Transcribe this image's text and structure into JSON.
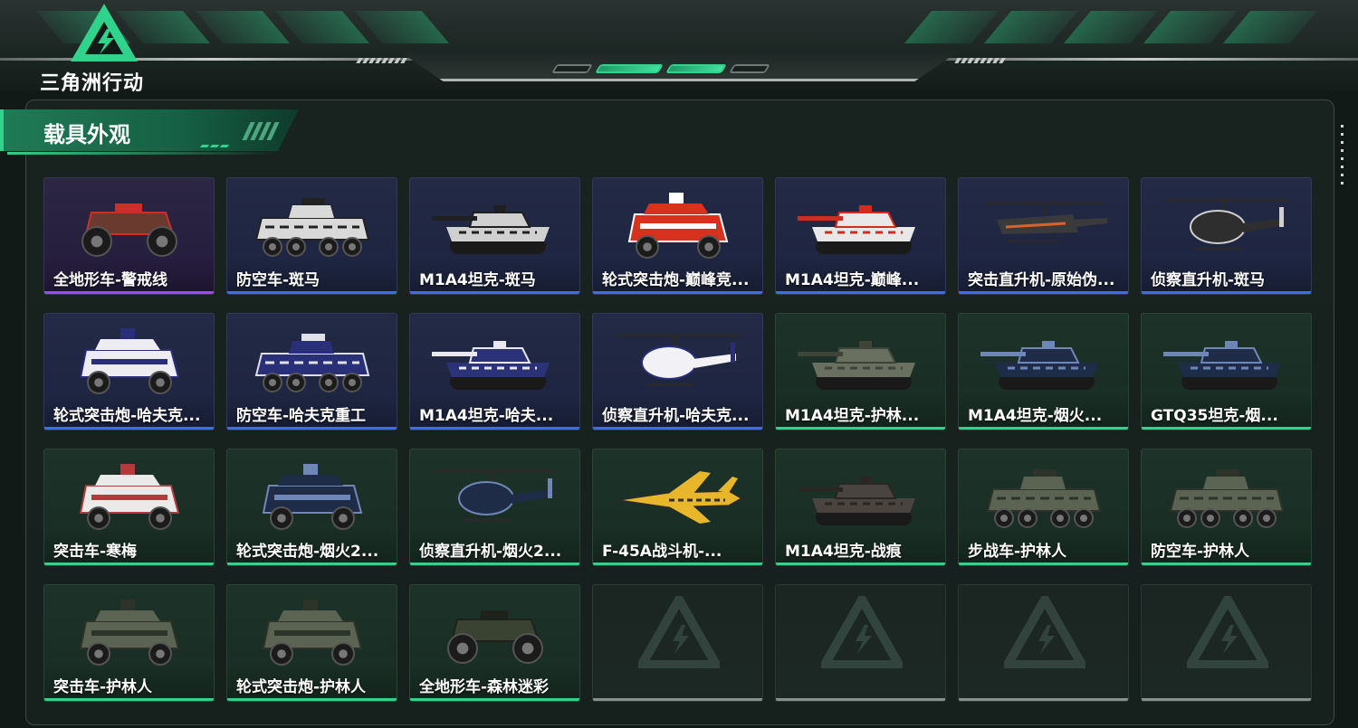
{
  "app": {
    "logo_text": "三角洲行动",
    "logo_icon": "delta-triangle-lightning-icon"
  },
  "section": {
    "title": "载具外观"
  },
  "colors": {
    "accent": "#2fd38c",
    "rarity_purple": "#9b4cf0",
    "rarity_blue": "#3a6ff0",
    "rarity_green": "#2fd38c",
    "empty_slot": "#8a908e"
  },
  "vehicles": [
    {
      "name": "全地形车-警戒线",
      "rarity": "purple",
      "kind": "atv",
      "paint": "#6b3a2e",
      "accent": "#c9302c"
    },
    {
      "name": "防空车-斑马",
      "rarity": "blue",
      "kind": "apc",
      "paint": "#d9d9d9",
      "accent": "#222222"
    },
    {
      "name": "M1A4坦克-斑马",
      "rarity": "blue",
      "kind": "tank",
      "paint": "#d0d0d0",
      "accent": "#202020"
    },
    {
      "name": "轮式突击炮-巅峰竞...",
      "rarity": "blue",
      "kind": "truck",
      "paint": "#d8321f",
      "accent": "#ffffff"
    },
    {
      "name": "M1A4坦克-巅峰...",
      "rarity": "blue",
      "kind": "tank",
      "paint": "#e8e8e8",
      "accent": "#d42a20"
    },
    {
      "name": "突击直升机-原始伪...",
      "rarity": "blue",
      "kind": "attack-heli",
      "paint": "#3a3a3a",
      "accent": "#d8632a"
    },
    {
      "name": "侦察直升机-斑马",
      "rarity": "blue",
      "kind": "scout-heli",
      "paint": "#2e2e2e",
      "accent": "#cfcfcf"
    },
    {
      "name": "轮式突击炮-哈夫克...",
      "rarity": "blue",
      "kind": "truck",
      "paint": "#ececf2",
      "accent": "#2a2e7a"
    },
    {
      "name": "防空车-哈夫克重工",
      "rarity": "blue",
      "kind": "apc",
      "paint": "#2a2f7a",
      "accent": "#e0e0ea"
    },
    {
      "name": "M1A4坦克-哈夫...",
      "rarity": "blue",
      "kind": "tank",
      "paint": "#2c3278",
      "accent": "#e8e8f0"
    },
    {
      "name": "侦察直升机-哈夫克...",
      "rarity": "blue",
      "kind": "scout-heli",
      "paint": "#f2f2f6",
      "accent": "#2a2e7a"
    },
    {
      "name": "M1A4坦克-护林...",
      "rarity": "green",
      "kind": "tank",
      "paint": "#6a7060",
      "accent": "#3e4438"
    },
    {
      "name": "M1A4坦克-烟火...",
      "rarity": "green",
      "kind": "tank",
      "paint": "#1f2c48",
      "accent": "#6f87b8"
    },
    {
      "name": "GTQ35坦克-烟...",
      "rarity": "green",
      "kind": "tank",
      "paint": "#1f2c48",
      "accent": "#6f87b8"
    },
    {
      "name": "突击车-寒梅",
      "rarity": "green",
      "kind": "truck",
      "paint": "#eaeaea",
      "accent": "#b23a3a"
    },
    {
      "name": "轮式突击炮-烟火2...",
      "rarity": "green",
      "kind": "truck",
      "paint": "#1f2c48",
      "accent": "#6f87b8"
    },
    {
      "name": "侦察直升机-烟火2...",
      "rarity": "green",
      "kind": "scout-heli",
      "paint": "#1f2c48",
      "accent": "#6f87b8"
    },
    {
      "name": "F-45A战斗机-...",
      "rarity": "green",
      "kind": "jet",
      "paint": "#e8b62a",
      "accent": "#2a2a2a"
    },
    {
      "name": "M1A4坦克-战痕",
      "rarity": "green",
      "kind": "tank",
      "paint": "#4a4440",
      "accent": "#2a2624"
    },
    {
      "name": "步战车-护林人",
      "rarity": "green",
      "kind": "apc",
      "paint": "#5b6452",
      "accent": "#2e3329"
    },
    {
      "name": "防空车-护林人",
      "rarity": "green",
      "kind": "apc",
      "paint": "#5b6452",
      "accent": "#2e3329"
    },
    {
      "name": "突击车-护林人",
      "rarity": "green",
      "kind": "truck",
      "paint": "#5b6452",
      "accent": "#2e3329"
    },
    {
      "name": "轮式突击炮-护林人",
      "rarity": "green",
      "kind": "truck",
      "paint": "#5b6452",
      "accent": "#2e3329"
    },
    {
      "name": "全地形车-森林迷彩",
      "rarity": "green",
      "kind": "atv",
      "paint": "#3a4232",
      "accent": "#1e221a"
    }
  ],
  "empty_slots": 4,
  "empty_slot_icon": "delta-logo-watermark-icon"
}
